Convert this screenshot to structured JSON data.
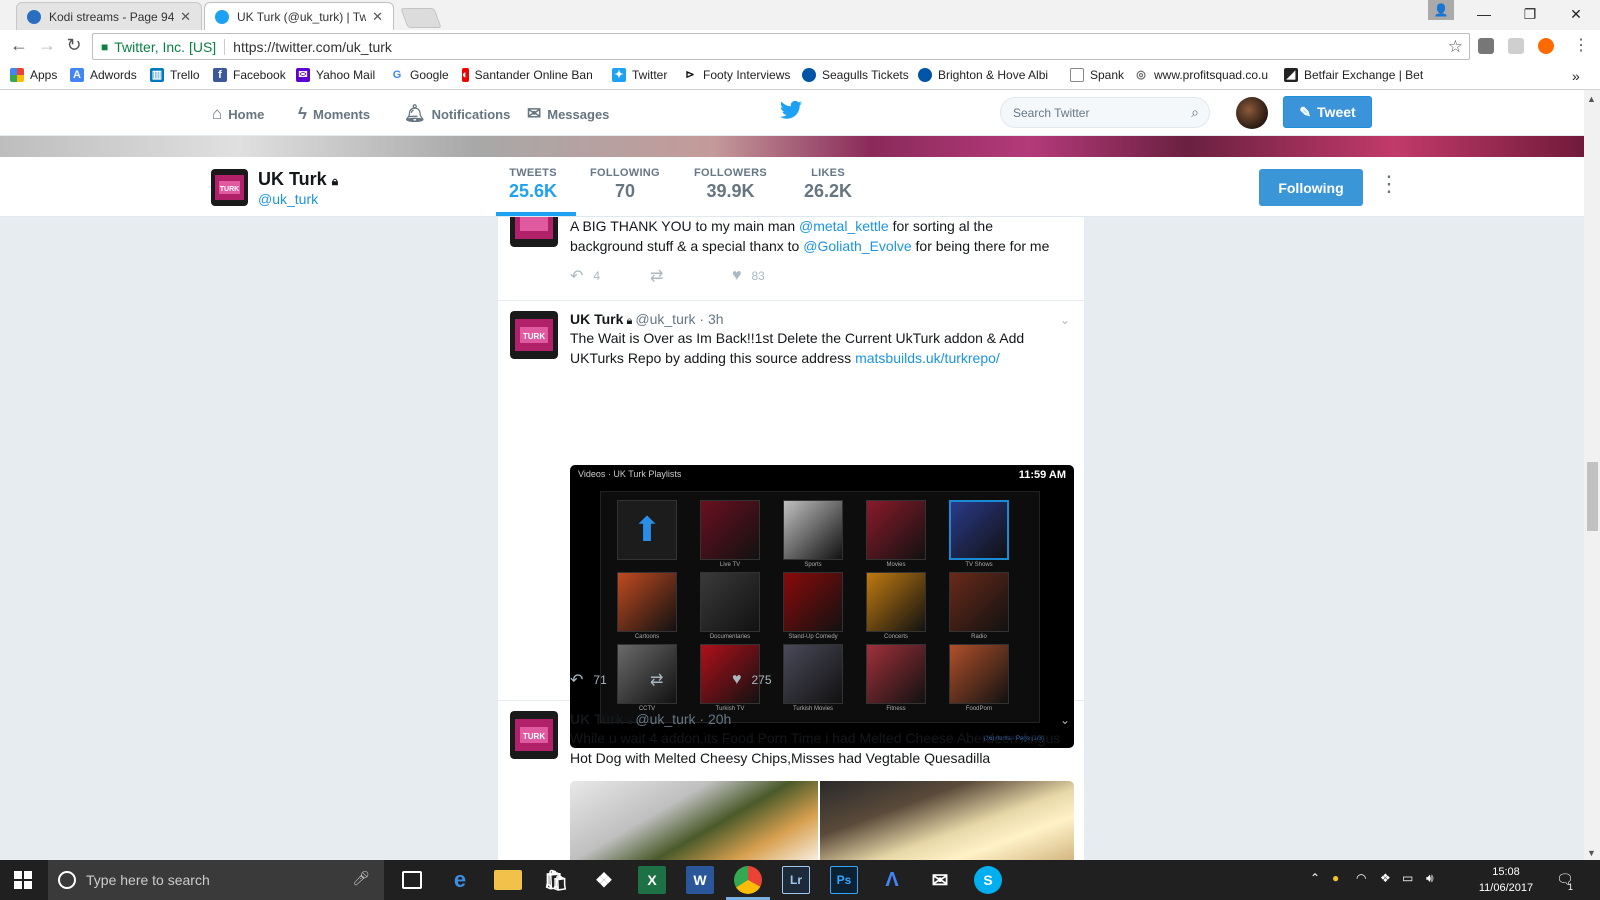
{
  "browser": {
    "tabs": [
      {
        "title": "Kodi streams - Page 94",
        "close": "✕"
      },
      {
        "title": "UK Turk (@uk_turk) | Twi",
        "close": "✕"
      }
    ],
    "window_controls": {
      "minimize": "—",
      "restore": "❐",
      "close": "✕"
    },
    "address": {
      "secure_label": "Twitter, Inc. [US]",
      "url_scheme": "https://",
      "url_host": "twitter.com/uk_turk"
    },
    "bookmarks": [
      "Apps",
      "Adwords",
      "Trello",
      "Facebook",
      "Yahoo Mail",
      "Google",
      "Santander Online Ban",
      "Twitter",
      "Footy Interviews",
      "Seagulls Tickets",
      "Brighton & Hove Albi",
      "Spank",
      "www.profitsquad.co.u",
      "Betfair Exchange | Bet"
    ],
    "bookmarks_overflow": "»"
  },
  "twitter": {
    "nav": {
      "home": "Home",
      "moments": "Moments",
      "notifications": "Notifications",
      "messages": "Messages",
      "search_placeholder": "Search Twitter",
      "tweet_button": "Tweet"
    },
    "profile": {
      "name": "UK Turk",
      "handle": "@uk_turk",
      "stats": [
        {
          "label": "TWEETS",
          "value": "25.6K"
        },
        {
          "label": "FOLLOWING",
          "value": "70"
        },
        {
          "label": "FOLLOWERS",
          "value": "39.9K"
        },
        {
          "label": "LIKES",
          "value": "26.2K"
        }
      ],
      "following_button": "Following"
    },
    "tweets": [
      {
        "text_a": "A BIG THANK YOU to my main man ",
        "mention1": "@metal_kettle",
        "text_b": " for sorting al the background stuff & a special thanx to ",
        "mention2": "@Goliath_Evolve",
        "text_c": " for being there for me",
        "replies": "4",
        "likes": "83"
      },
      {
        "name": "UK Turk",
        "handle": "@uk_turk",
        "time": "· 3h",
        "text": "The Wait is Over as Im Back!!1st Delete the Current UkTurk addon & Add UKTurks Repo by adding this source address ",
        "link": "matsbuilds.uk/turkrepo/",
        "media": {
          "breadcrumb": "Videos · UK Turk Playlists",
          "clock": "11:59 AM",
          "tiles": [
            "",
            "Live TV",
            "Sports",
            "Movies",
            "TV Shows",
            "Cartoons",
            "Documentaries",
            "Stand-Up Comedy",
            "Concerts",
            "Radio",
            "CCTV",
            "Turkish TV",
            "Turkish Movies",
            "Fitness",
            "FoodPorn"
          ],
          "footer": "(16) Items - Page (1/3)"
        },
        "replies": "71",
        "likes": "275"
      },
      {
        "name": "UK Turk",
        "handle": "@uk_turk",
        "time": "· 20h",
        "text": "While u wait 4 addon,its Food Porn Time i had Melted Cheese Aberdeen Angus Hot Dog with Melted Cheesy Chips,Misses had Vegtable Quesadilla"
      }
    ]
  },
  "taskbar": {
    "search_placeholder": "Type here to search",
    "time": "15:08",
    "date": "11/06/2017",
    "notifications_count": "1"
  },
  "colors": {
    "twitter_blue": "#1da1f2",
    "link": "#1b95e0",
    "profile_tile": "#8a1a5a"
  }
}
